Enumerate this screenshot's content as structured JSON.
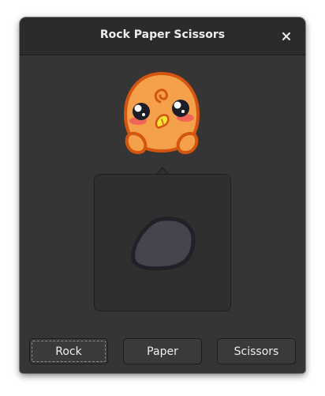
{
  "window": {
    "title": "Rock Paper Scissors",
    "close_icon": "close-icon"
  },
  "mascot": {
    "icon": "chick-mascot-icon"
  },
  "result": {
    "icon": "rock-icon"
  },
  "buttons": {
    "rock": "Rock",
    "paper": "Paper",
    "scissors": "Scissors"
  },
  "colors": {
    "window_bg": "#353535",
    "header_bg": "#2b2b2b",
    "popover_bg": "#2f2f2f",
    "text": "#eeeeec",
    "mascot_orange": "#f5a04a",
    "rock_fill": "#47444e"
  }
}
